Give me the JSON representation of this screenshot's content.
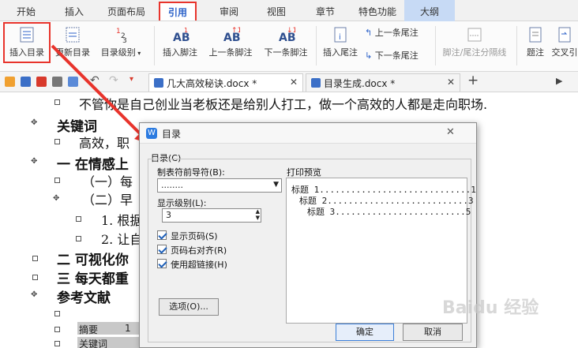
{
  "menu": {
    "tabs": [
      "开始",
      "插入",
      "页面布局",
      "引用",
      "审阅",
      "视图",
      "章节",
      "特色功能",
      "大纲"
    ],
    "active": "引用"
  },
  "ribbon": {
    "insert_toc": "插入目录",
    "update_toc": "更新目录",
    "toc_level": "目录级别",
    "insert_footnote": "插入脚注",
    "prev_footnote": "上一条脚注",
    "next_footnote": "下一条脚注",
    "insert_endnote": "插入尾注",
    "prev_endnote": "上一条尾注",
    "next_endnote": "下一条尾注",
    "separator_line": "脚注/尾注分隔线",
    "caption": "题注",
    "cross_ref": "交叉引"
  },
  "doc_tabs": [
    {
      "title": "几大高效秘诀.docx *"
    },
    {
      "title": "目录生成.docx *"
    }
  ],
  "document": {
    "lines": [
      "不管你是自己创业当老板还是给别人打工，做一个高效的人都是走向职场.",
      "关键词",
      "高效，职",
      "一 在情感上",
      "（一）每",
      "（二）早",
      "1. 根据",
      "2. 让自",
      "二 可视化你",
      "三 每天都重",
      "参考文献",
      "摘要",
      "1",
      "关键词"
    ]
  },
  "dialog": {
    "title": "目录",
    "section_label": "目录(C)",
    "leader_label": "制表符前导符(B):",
    "leader_value": "........",
    "levels_label": "显示级别(L):",
    "levels_value": "3",
    "show_page_numbers": "显示页码(S)",
    "right_align": "页码右对齐(R)",
    "use_hyperlinks": "使用超链接(H)",
    "options_button": "选项(O)...",
    "preview_label": "打印预览",
    "preview": [
      {
        "text": "标题 1.............................1"
      },
      {
        "text": "标题 2...........................3"
      },
      {
        "text": "标题 3.........................5"
      }
    ],
    "ok": "确定",
    "cancel": "取消"
  },
  "watermark": "Baidu 经验",
  "colors": {
    "highlight": "#e8342c",
    "accent": "#2c62c9",
    "outline_tab": "#c7daf5"
  }
}
